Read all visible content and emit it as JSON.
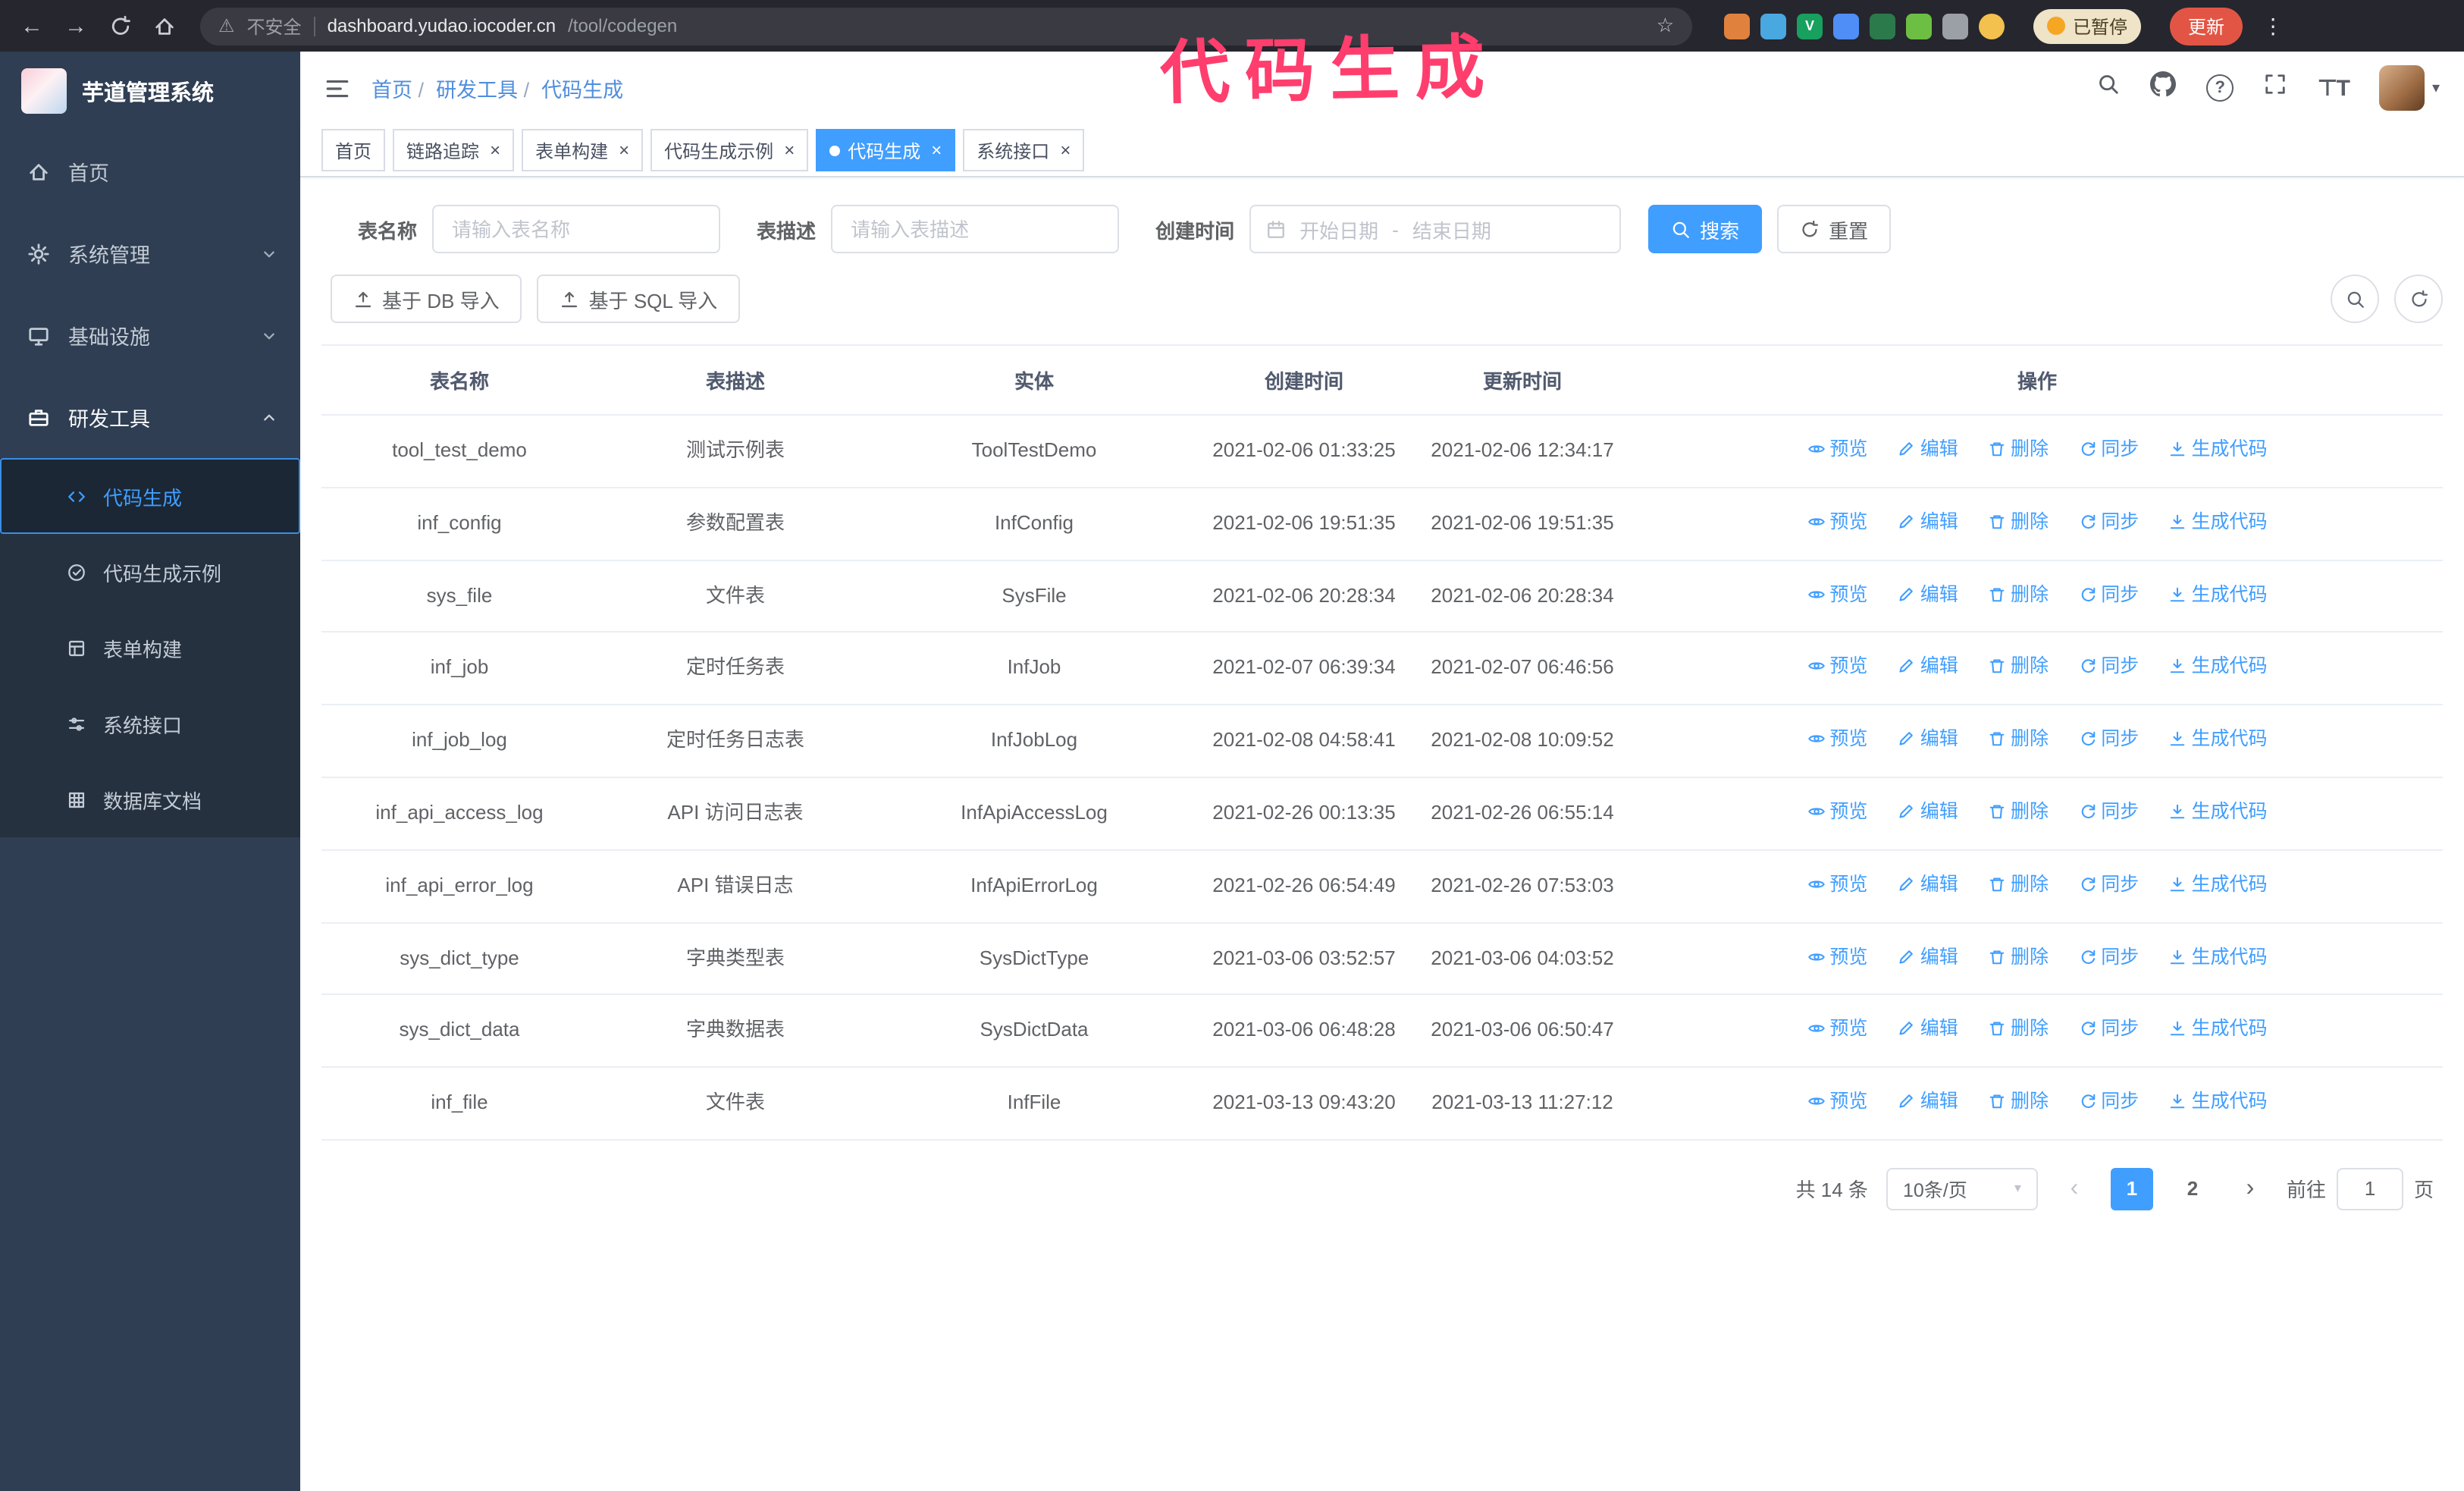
{
  "annotation": {
    "text": "代码生成"
  },
  "browser": {
    "insecure_label": "不安全",
    "url_host": "dashboard.yudao.iocoder.cn",
    "url_path": "/tool/codegen",
    "paused_label": "已暂停",
    "update_label": "更新",
    "extensions": [
      {
        "name": "orange-extension-icon",
        "color": "#e0823d",
        "glyph": ""
      },
      {
        "name": "blue-extension-icon",
        "color": "#4aa8e0",
        "glyph": ""
      },
      {
        "name": "v-extension-icon",
        "color": "#18a05e",
        "glyph": "V"
      },
      {
        "name": "people-extension-icon",
        "color": "#4f8ef7",
        "glyph": ""
      },
      {
        "name": "teal-extension-icon",
        "color": "#2b7a4b",
        "glyph": ""
      },
      {
        "name": "leaf-extension-icon",
        "color": "#6cbf43",
        "glyph": ""
      },
      {
        "name": "puzzle-extension-icon",
        "color": "#9aa0a6",
        "glyph": ""
      },
      {
        "name": "profile-avatar-icon",
        "color": "#f2c14e",
        "glyph": "",
        "round": true
      }
    ]
  },
  "sidebar": {
    "logo_title": "芋道管理系统",
    "items": [
      {
        "label": "首页",
        "icon": "home-icon",
        "expandable": false
      },
      {
        "label": "系统管理",
        "icon": "gear-icon",
        "expandable": true
      },
      {
        "label": "基础设施",
        "icon": "infra-icon",
        "expandable": true
      },
      {
        "label": "研发工具",
        "icon": "tools-icon",
        "expandable": true,
        "expanded": true
      }
    ],
    "submenu": [
      {
        "label": "代码生成",
        "icon": "code-icon",
        "active": true
      },
      {
        "label": "代码生成示例",
        "icon": "example-icon"
      },
      {
        "label": "表单构建",
        "icon": "form-icon"
      },
      {
        "label": "系统接口",
        "icon": "api-icon"
      },
      {
        "label": "数据库文档",
        "icon": "db-icon"
      }
    ]
  },
  "header": {
    "breadcrumb": [
      "首页",
      "研发工具",
      "代码生成"
    ],
    "separator": "/"
  },
  "tabs": [
    {
      "label": "首页",
      "closable": false
    },
    {
      "label": "链路追踪",
      "closable": true
    },
    {
      "label": "表单构建",
      "closable": true
    },
    {
      "label": "代码生成示例",
      "closable": true
    },
    {
      "label": "代码生成",
      "closable": true,
      "active": true
    },
    {
      "label": "系统接口",
      "closable": true
    }
  ],
  "filters": {
    "table_name_label": "表名称",
    "table_name_placeholder": "请输入表名称",
    "table_desc_label": "表描述",
    "table_desc_placeholder": "请输入表描述",
    "create_time_label": "创建时间",
    "start_placeholder": "开始日期",
    "range_separator": "-",
    "end_placeholder": "结束日期",
    "search_label": "搜索",
    "reset_label": "重置"
  },
  "toolbar": {
    "import_db_label": "基于 DB 导入",
    "import_sql_label": "基于 SQL 导入"
  },
  "table": {
    "columns": [
      "表名称",
      "表描述",
      "实体",
      "创建时间",
      "更新时间",
      "操作"
    ],
    "rows": [
      {
        "name": "tool_test_demo",
        "desc": "测试示例表",
        "entity": "ToolTestDemo",
        "created": "2021-02-06 01:33:25",
        "updated": "2021-02-06 12:34:17"
      },
      {
        "name": "inf_config",
        "desc": "参数配置表",
        "entity": "InfConfig",
        "created": "2021-02-06 19:51:35",
        "updated": "2021-02-06 19:51:35"
      },
      {
        "name": "sys_file",
        "desc": "文件表",
        "entity": "SysFile",
        "created": "2021-02-06 20:28:34",
        "updated": "2021-02-06 20:28:34"
      },
      {
        "name": "inf_job",
        "desc": "定时任务表",
        "entity": "InfJob",
        "created": "2021-02-07 06:39:34",
        "updated": "2021-02-07 06:46:56"
      },
      {
        "name": "inf_job_log",
        "desc": "定时任务日志表",
        "entity": "InfJobLog",
        "created": "2021-02-08 04:58:41",
        "updated": "2021-02-08 10:09:52"
      },
      {
        "name": "inf_api_access_log",
        "desc": "API 访问日志表",
        "entity": "InfApiAccessLog",
        "created": "2021-02-26 00:13:35",
        "updated": "2021-02-26 06:55:14"
      },
      {
        "name": "inf_api_error_log",
        "desc": "API 错误日志",
        "entity": "InfApiErrorLog",
        "created": "2021-02-26 06:54:49",
        "updated": "2021-02-26 07:53:03"
      },
      {
        "name": "sys_dict_type",
        "desc": "字典类型表",
        "entity": "SysDictType",
        "created": "2021-03-06 03:52:57",
        "updated": "2021-03-06 04:03:52"
      },
      {
        "name": "sys_dict_data",
        "desc": "字典数据表",
        "entity": "SysDictData",
        "created": "2021-03-06 06:48:28",
        "updated": "2021-03-06 06:50:47"
      },
      {
        "name": "inf_file",
        "desc": "文件表",
        "entity": "InfFile",
        "created": "2021-03-13 09:43:20",
        "updated": "2021-03-13 11:27:12"
      }
    ],
    "row_actions": [
      {
        "label": "预览",
        "icon": "eye-icon"
      },
      {
        "label": "编辑",
        "icon": "edit-icon"
      },
      {
        "label": "删除",
        "icon": "delete-icon"
      },
      {
        "label": "同步",
        "icon": "sync-icon"
      },
      {
        "label": "生成代码",
        "icon": "download-icon"
      }
    ]
  },
  "pagination": {
    "total_text": "共 14 条",
    "page_size": "10条/页",
    "pages": [
      {
        "label": "1",
        "active": true
      },
      {
        "label": "2"
      }
    ],
    "goto_label": "前往",
    "goto_value": "1",
    "page_suffix": "页"
  },
  "accent_color": "#409eff",
  "annotation_color": "#ff3e6e"
}
